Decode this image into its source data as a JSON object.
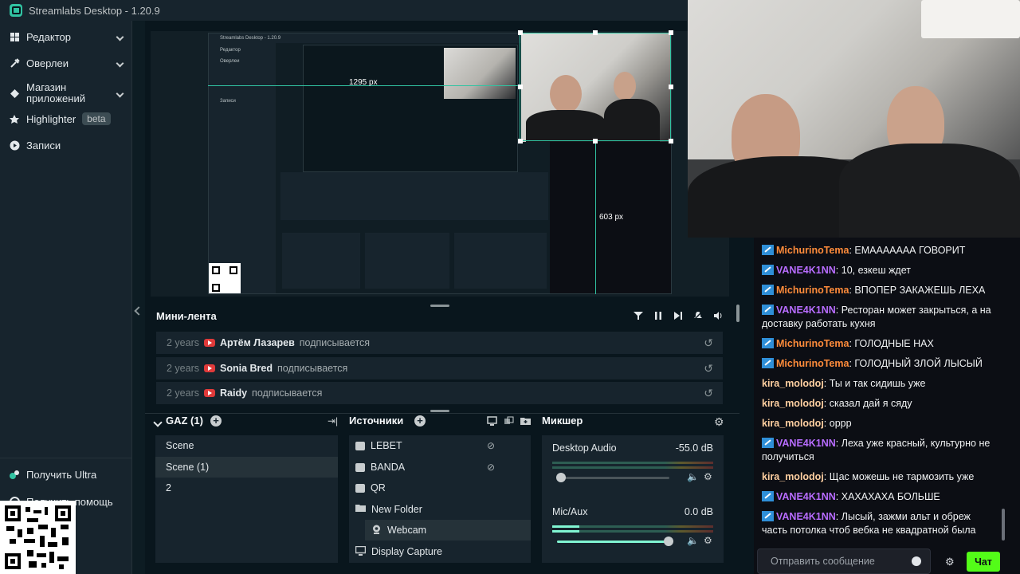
{
  "window": {
    "title": "Streamlabs Desktop - 1.20.9"
  },
  "sidebar": {
    "items": [
      {
        "label": "Редактор",
        "icon": "editor-icon",
        "has_chevron": true
      },
      {
        "label": "Оверлеи",
        "icon": "overlays-icon",
        "has_chevron": true
      },
      {
        "label": "Магазин приложений",
        "icon": "app-store-icon",
        "has_chevron": true
      },
      {
        "label": "Highlighter",
        "icon": "highlighter-icon",
        "badge": "beta"
      },
      {
        "label": "Записи",
        "icon": "recordings-icon"
      }
    ],
    "bottom": [
      {
        "label": "Получить Ultra",
        "icon": "ultra-icon"
      },
      {
        "label": "Получить помощь",
        "icon": "help-icon"
      }
    ]
  },
  "preview": {
    "nested_title": "Streamlabs Desktop - 1.20.9",
    "width_label": "1295 px",
    "height_label": "603 px"
  },
  "mini_feed": {
    "title": "Мини-лента",
    "events": [
      {
        "time": "2 years",
        "name": "Артём Лазарев",
        "action": "подписывается"
      },
      {
        "time": "2 years",
        "name": "Sonia Bred",
        "action": "подписывается"
      },
      {
        "time": "2 years",
        "name": "Raidy",
        "action": "подписывается"
      }
    ]
  },
  "scenes": {
    "title": "GAZ (1)",
    "items": [
      "Scene",
      "Scene (1)",
      "2"
    ],
    "selected_index": 1
  },
  "sources": {
    "title": "Источники",
    "items": [
      {
        "label": "LEBET",
        "icon": "image-icon",
        "hidden": true
      },
      {
        "label": "BANDA",
        "icon": "image-icon",
        "hidden": true
      },
      {
        "label": "QR",
        "icon": "image-icon",
        "hidden": false
      },
      {
        "label": "New Folder",
        "icon": "folder-icon",
        "hidden": false
      },
      {
        "label": "Webcam",
        "icon": "webcam-icon",
        "hidden": false,
        "nested": true,
        "selected": true
      },
      {
        "label": "Display Capture",
        "icon": "display-icon",
        "hidden": false
      }
    ]
  },
  "mixer": {
    "title": "Микшер",
    "channels": [
      {
        "name": "Desktop Audio",
        "value": "-55.0 dB",
        "level": 0.0,
        "volume": 0.05
      },
      {
        "name": "Mic/Aux",
        "value": "0.0 dB",
        "level": 0.17,
        "volume": 1.0
      }
    ]
  },
  "chat": {
    "messages": [
      {
        "user": "MichurinoTema",
        "color": "#ff8c3b",
        "badge": true,
        "text": "ЕМААААААА ГОВОРИТ"
      },
      {
        "user": "VANE4K1NN",
        "color": "#b86cff",
        "badge": true,
        "text": "10, езкеш ждет"
      },
      {
        "user": "MichurinoTema",
        "color": "#ff8c3b",
        "badge": true,
        "text": "ВПОПЕР ЗАКАЖЕШЬ ЛЕХА"
      },
      {
        "user": "VANE4K1NN",
        "color": "#b86cff",
        "badge": true,
        "text": "Ресторан может закрыться, а на доставку работать кухня"
      },
      {
        "user": "MichurinoTema",
        "color": "#ff8c3b",
        "badge": true,
        "text": "ГОЛОДНЫЕ НАХ"
      },
      {
        "user": "MichurinoTema",
        "color": "#ff8c3b",
        "badge": true,
        "text": "ГОЛОДНЫЙ ЗЛОЙ ЛЫСЫЙ"
      },
      {
        "user": "kira_molodoj",
        "color": "#ffd0a1",
        "badge": false,
        "text": "Ты и так сидишь уже"
      },
      {
        "user": "kira_molodoj",
        "color": "#ffd0a1",
        "badge": false,
        "text": "сказал дай я сяду"
      },
      {
        "user": "kira_molodoj",
        "color": "#ffd0a1",
        "badge": false,
        "text": "оррр"
      },
      {
        "user": "VANE4K1NN",
        "color": "#b86cff",
        "badge": true,
        "text": "Леха уже красный, культурно не получиться"
      },
      {
        "user": "kira_molodoj",
        "color": "#ffd0a1",
        "badge": false,
        "text": "Щас можешь не тармозить уже"
      },
      {
        "user": "VANE4K1NN",
        "color": "#b86cff",
        "badge": true,
        "text": "ХАХАХАХА БОЛЬШЕ"
      },
      {
        "user": "VANE4K1NN",
        "color": "#b86cff",
        "badge": true,
        "text": "Лысый, зажми альт и обреж часть потолка чтоб вебка не квадратной была"
      }
    ],
    "input_placeholder": "Отправить сообщение",
    "send_label": "Чат"
  }
}
